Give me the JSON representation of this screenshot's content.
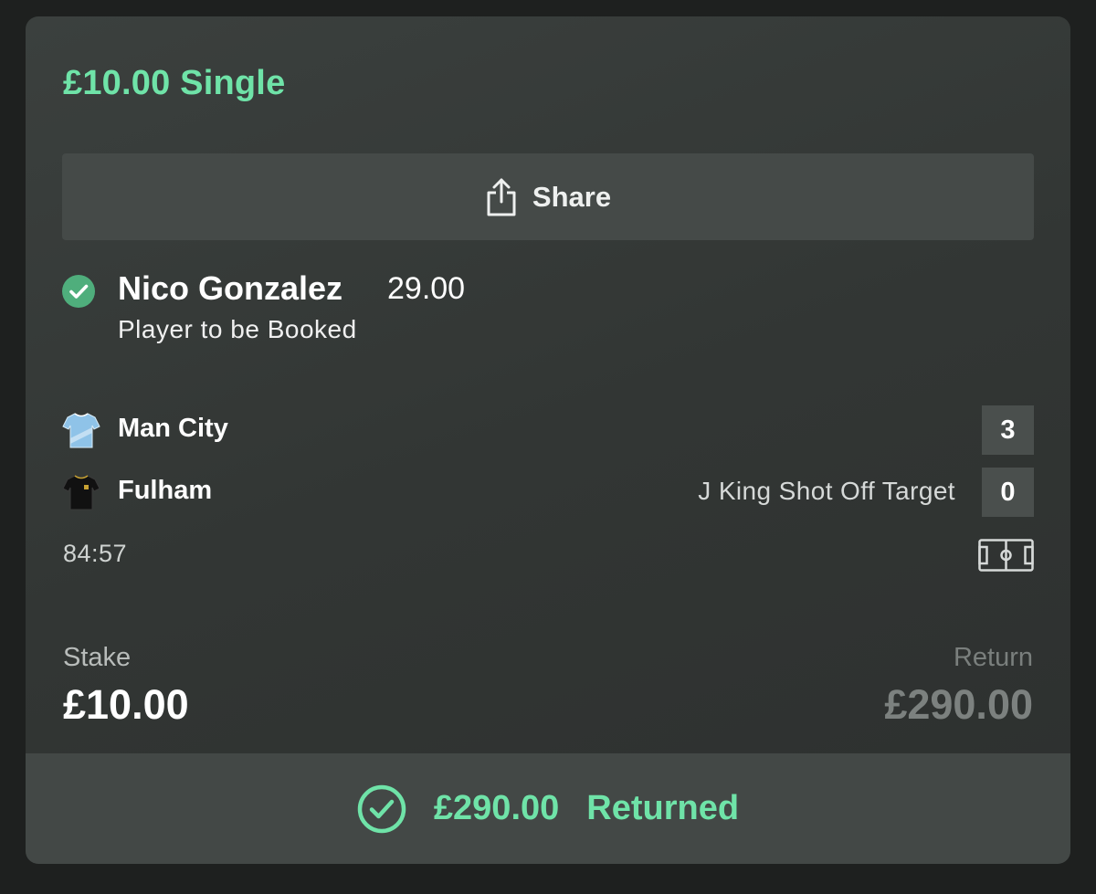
{
  "bet": {
    "title": "£10.00 Single",
    "share_label": "Share"
  },
  "selection": {
    "name": "Nico Gonzalez",
    "odds": "29.00",
    "market": "Player to be Booked"
  },
  "match": {
    "home": {
      "name": "Man City",
      "score": "3"
    },
    "away": {
      "name": "Fulham",
      "score": "0",
      "event": "J King Shot Off Target"
    },
    "time": "84:57"
  },
  "stake": {
    "label": "Stake",
    "value": "£10.00"
  },
  "return": {
    "label": "Return",
    "value": "£290.00"
  },
  "result": {
    "amount": "£290.00",
    "text": "Returned"
  },
  "icons": {
    "share": "share-icon",
    "check": "check-circle-icon",
    "home_kit": "home-kit-icon",
    "away_kit": "away-kit-icon",
    "pitch": "pitch-icon",
    "returned": "check-circle-outline-icon"
  },
  "colors": {
    "accent": "#6fe3a8",
    "selection_check": "#4fae7c",
    "home_kit": "#8fc3e8",
    "away_kit": "#111111"
  }
}
